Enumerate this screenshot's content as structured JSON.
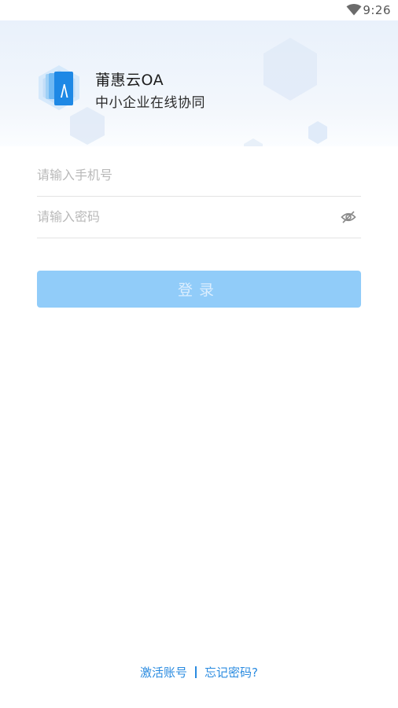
{
  "status_bar": {
    "time": "9:26",
    "wifi_icon": "wifi-icon"
  },
  "header": {
    "app_name": "莆惠云OA",
    "slogan": "中小企业在线协同",
    "logo_icon": "app-logo-icon"
  },
  "form": {
    "phone": {
      "placeholder": "请输入手机号",
      "value": ""
    },
    "password": {
      "placeholder": "请输入密码",
      "value": "",
      "toggle_icon": "eye-off-icon"
    },
    "login_label": "登录"
  },
  "footer": {
    "activate_label": "激活账号",
    "forgot_label": "忘记密码?"
  },
  "colors": {
    "accent": "#2a8be0",
    "button_disabled": "#91ccf9",
    "header_bg": "#e9f1fb"
  }
}
